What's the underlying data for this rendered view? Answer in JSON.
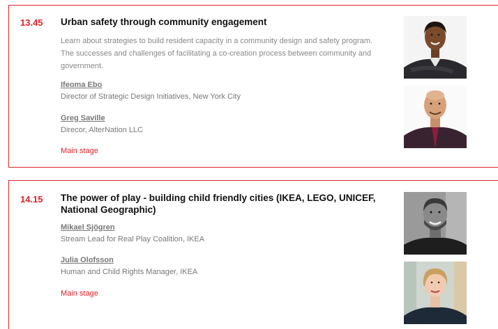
{
  "sessions": [
    {
      "time": "13.45",
      "title_lines": [
        "Urban safety through community engagement"
      ],
      "description_lines": [
        "Learn about strategies to build resident capacity in a community design and safety program.",
        "The successes and challenges of facilitating a co-creation process between community and",
        "government."
      ],
      "speakers": [
        {
          "name": "Ifeoma Ebo",
          "role": "Director of Strategic Design Initiatives, New York City"
        },
        {
          "name": "Greg Saville",
          "role": "Direcor, AlterNation LLC"
        }
      ],
      "venue": "Main stage"
    },
    {
      "time": "14.15",
      "title_lines": [
        "The power of play - building child friendly cities (IKEA, LEGO, UNICEF,",
        "National Geographic)"
      ],
      "speakers": [
        {
          "name": "Mikael Sjögren",
          "role": "Stream Lead for Real Play Coalition, IKEA"
        },
        {
          "name": "Julia Olofsson",
          "role": "Human and Child Rights Manager, IKEA"
        }
      ],
      "venue": "Main stage"
    }
  ],
  "colors": {
    "accent": "#d9222a",
    "title": "#111111",
    "muted": "#888888"
  }
}
